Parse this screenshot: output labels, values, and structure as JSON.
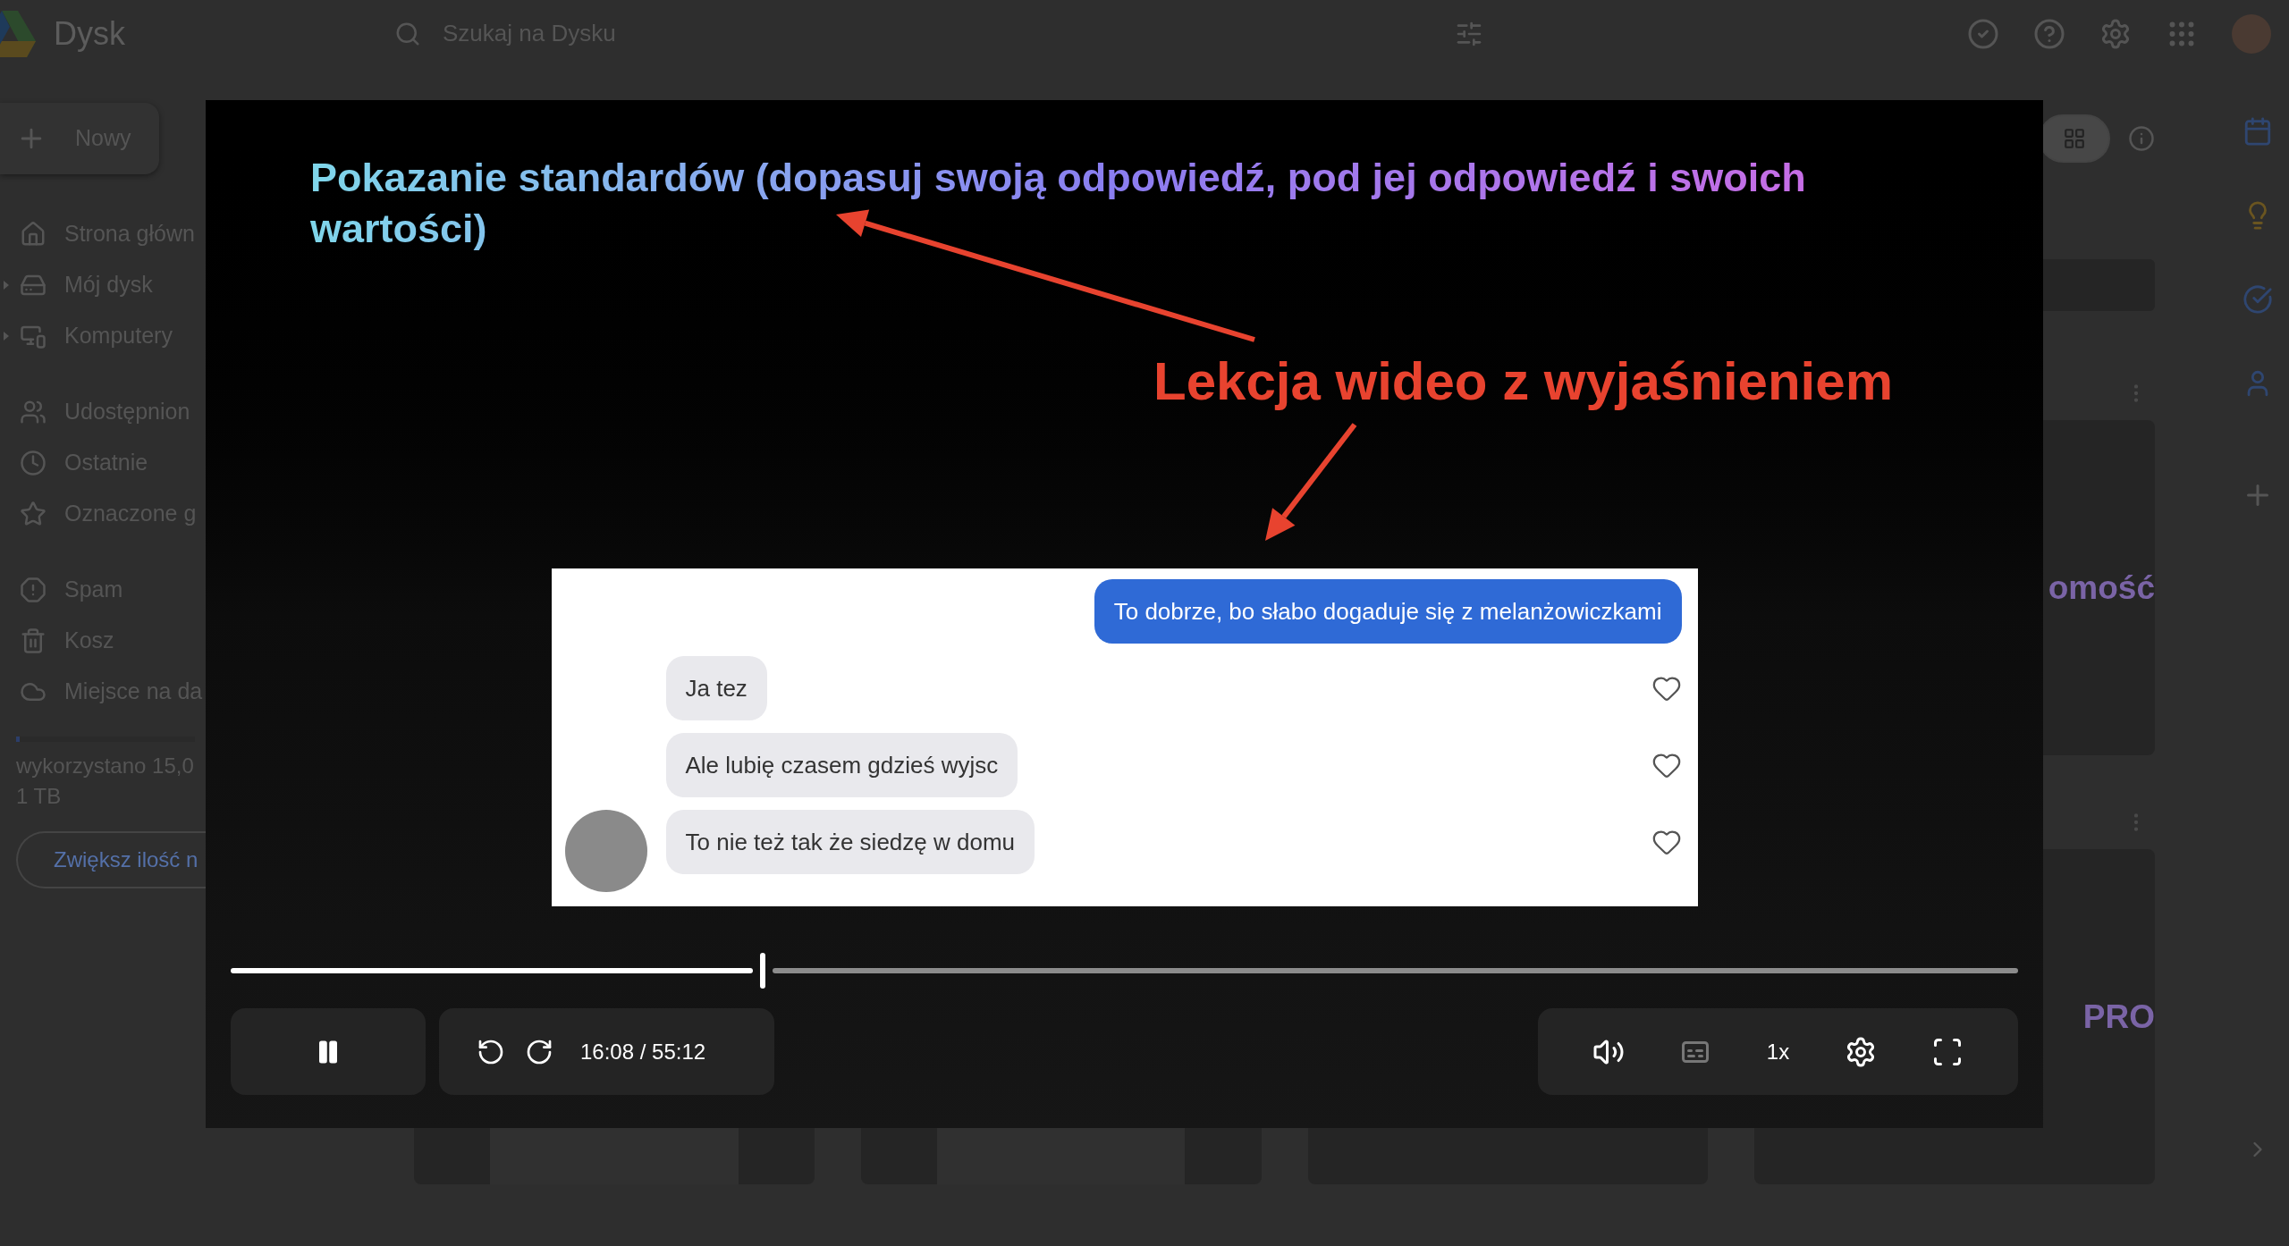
{
  "drive": {
    "app_name": "Dysk",
    "search": {
      "placeholder": "Szukaj na Dysku"
    },
    "new_button": "Nowy",
    "sidebar": {
      "items": [
        {
          "label": "Strona główn",
          "expandable": false
        },
        {
          "label": "Mój dysk",
          "expandable": true
        },
        {
          "label": "Komputery",
          "expandable": true
        },
        {
          "label": "Udostępnion",
          "expandable": false
        },
        {
          "label": "Ostatnie",
          "expandable": false
        },
        {
          "label": "Oznaczone g",
          "expandable": false
        },
        {
          "label": "Spam",
          "expandable": false
        },
        {
          "label": "Kosz",
          "expandable": false
        },
        {
          "label": "Miejsce na da",
          "expandable": false
        }
      ]
    },
    "storage": {
      "used": "wykorzystano 15,0",
      "total": "1 TB",
      "level": 0.02,
      "button": "Zwiększ ilość n"
    },
    "grid_view": {
      "selected": true
    },
    "cards": [
      {
        "kind": "text",
        "text": "omość"
      },
      {
        "kind": "document"
      },
      {
        "kind": "document"
      },
      {
        "kind": "blank"
      },
      {
        "kind": "text",
        "text": "PRO"
      }
    ]
  },
  "player": {
    "title": "Pokazanie standardów (dopasuj swoją odpowiedź, pod jej odpowiedź i swoich wartości)",
    "annotation": "Lekcja wideo z wyjaśnieniem",
    "messages": [
      {
        "text": "To dobrze, bo słabo dogaduje się z melanżowiczkami",
        "sent": true
      },
      {
        "text": "Ja tez",
        "sent": false,
        "liked": false
      },
      {
        "text": "Ale lubię czasem gdzieś wyjsc",
        "sent": false,
        "liked": false
      },
      {
        "text": "To nie też tak że siedzę w domu",
        "sent": false,
        "liked": false
      }
    ],
    "progress": {
      "level": 0.292
    },
    "playing": true,
    "time": "16:08 / 55:12",
    "speed": "1x",
    "captions": false
  }
}
